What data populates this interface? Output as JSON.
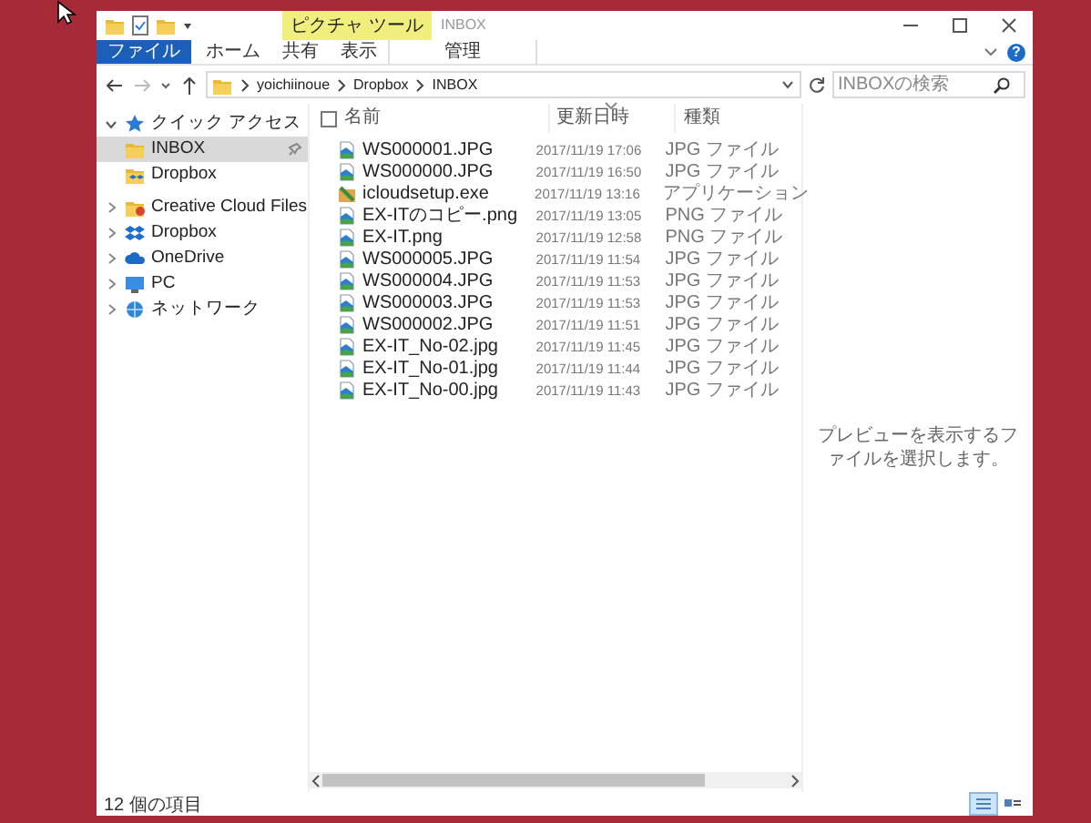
{
  "title_bar": {
    "context_group": "ピクチャ ツール",
    "title": "INBOX"
  },
  "ribbon_tabs": [
    {
      "label": "ファイル",
      "kind": "file",
      "selected": false
    },
    {
      "label": "ホーム",
      "kind": "tab",
      "selected": false
    },
    {
      "label": "共有",
      "kind": "tab",
      "selected": false
    },
    {
      "label": "表示",
      "kind": "tab",
      "selected": false
    },
    {
      "label": "管理",
      "kind": "context",
      "selected": false
    }
  ],
  "help": "?",
  "address_bar": {
    "path": [
      "yoichiinoue",
      "Dropbox",
      "INBOX"
    ]
  },
  "search": {
    "placeholder": "INBOXの検索"
  },
  "navigation": [
    {
      "label": "クイック アクセス",
      "kind": "star",
      "expanded": true,
      "children": [
        {
          "label": "INBOX",
          "kind": "folder",
          "selected": true,
          "pinned": true
        },
        {
          "label": "Dropbox",
          "kind": "dropbox-folder",
          "selected": false,
          "pinned": false
        }
      ]
    },
    {
      "label": "Creative Cloud Files",
      "kind": "cc-folder",
      "expanded": false
    },
    {
      "label": "Dropbox",
      "kind": "dropbox",
      "expanded": false
    },
    {
      "label": "OneDrive",
      "kind": "cloud",
      "expanded": false
    },
    {
      "label": "PC",
      "kind": "pc",
      "expanded": false
    },
    {
      "label": "ネットワーク",
      "kind": "network",
      "expanded": false
    }
  ],
  "select_all": {
    "checked": false
  },
  "columns": [
    {
      "label": "名前",
      "sorted": false
    },
    {
      "label": "更新日時",
      "sorted": true
    },
    {
      "label": "種類",
      "sorted": false
    }
  ],
  "files": [
    {
      "name": "WS000001.JPG",
      "modified": "2017/11/19 17:06",
      "type": "JPG ファイル",
      "kind": "image"
    },
    {
      "name": "WS000000.JPG",
      "modified": "2017/11/19 16:50",
      "type": "JPG ファイル",
      "kind": "image"
    },
    {
      "name": "icloudsetup.exe",
      "modified": "2017/11/19 13:16",
      "type": "アプリケーション",
      "kind": "app"
    },
    {
      "name": "EX-ITのコピー.png",
      "modified": "2017/11/19 13:05",
      "type": "PNG ファイル",
      "kind": "image"
    },
    {
      "name": "EX-IT.png",
      "modified": "2017/11/19 12:58",
      "type": "PNG ファイル",
      "kind": "image"
    },
    {
      "name": "WS000005.JPG",
      "modified": "2017/11/19 11:54",
      "type": "JPG ファイル",
      "kind": "image"
    },
    {
      "name": "WS000004.JPG",
      "modified": "2017/11/19 11:53",
      "type": "JPG ファイル",
      "kind": "image"
    },
    {
      "name": "WS000003.JPG",
      "modified": "2017/11/19 11:53",
      "type": "JPG ファイル",
      "kind": "image"
    },
    {
      "name": "WS000002.JPG",
      "modified": "2017/11/19 11:51",
      "type": "JPG ファイル",
      "kind": "image"
    },
    {
      "name": "EX-IT_No-02.jpg",
      "modified": "2017/11/19 11:45",
      "type": "JPG ファイル",
      "kind": "image"
    },
    {
      "name": "EX-IT_No-01.jpg",
      "modified": "2017/11/19 11:44",
      "type": "JPG ファイル",
      "kind": "image"
    },
    {
      "name": "EX-IT_No-00.jpg",
      "modified": "2017/11/19 11:43",
      "type": "JPG ファイル",
      "kind": "image"
    }
  ],
  "preview_message": "プレビューを表示するファイルを選択します。",
  "status_bar": {
    "item_count": "12 個の項目"
  },
  "view_buttons": [
    {
      "kind": "details",
      "selected": true
    },
    {
      "kind": "tiles",
      "selected": false
    }
  ]
}
